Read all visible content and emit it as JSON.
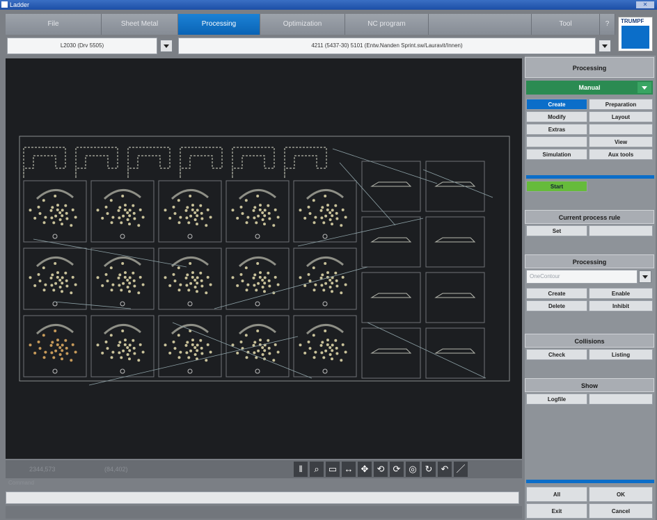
{
  "window": {
    "title": "Ladder"
  },
  "tabs": [
    {
      "label": "File",
      "active": false
    },
    {
      "label": "Sheet Metal",
      "active": false
    },
    {
      "label": "Processing",
      "active": true
    },
    {
      "label": "Optimization",
      "active": false
    },
    {
      "label": "NC program",
      "active": false
    },
    {
      "label": "",
      "active": false
    },
    {
      "label": "Tool",
      "active": false
    },
    {
      "label": "?",
      "active": false
    }
  ],
  "logo": {
    "text": "TRUMPF"
  },
  "selectors": {
    "machine": "L2030 (Drv 5505)",
    "program": "4211 (5437-30)  5101 (Entw.Nanden Sprint.sw/Lauravit/Innen)"
  },
  "status": {
    "coord1": "2344,573",
    "coord2": "(84,402)"
  },
  "toolbar_icons": [
    "pause-icon",
    "zoom-icon",
    "fit-icon",
    "measure-icon",
    "move-icon",
    "rotate-left-icon",
    "rotate-right-icon",
    "redraw-icon",
    "refresh-icon",
    "undo-icon",
    "draw-line-icon"
  ],
  "command": {
    "label": "Command"
  },
  "right_panel": {
    "processing_header": "Processing",
    "mode": "Manual",
    "buttons": {
      "create": "Create",
      "preparation": "Preparation",
      "modify": "Modify",
      "layout": "Layout",
      "extras": "Extras",
      "view": "View",
      "simulation": "Simulation",
      "aux_tools": "Aux tools",
      "start": "Start"
    },
    "current_rule_header": "Current process rule",
    "set": "Set",
    "processing2_header": "Processing",
    "contour_placeholder": "OneContour",
    "create2": "Create",
    "enable": "Enable",
    "delete": "Delete",
    "inhibit": "Inhibit",
    "collisions_header": "Collisions",
    "check": "Check",
    "listing": "Listing",
    "show_header": "Show",
    "logfile": "Logfile",
    "bottom": {
      "all": "All",
      "ok": "OK",
      "exit": "Exit",
      "cancel": "Cancel"
    }
  }
}
